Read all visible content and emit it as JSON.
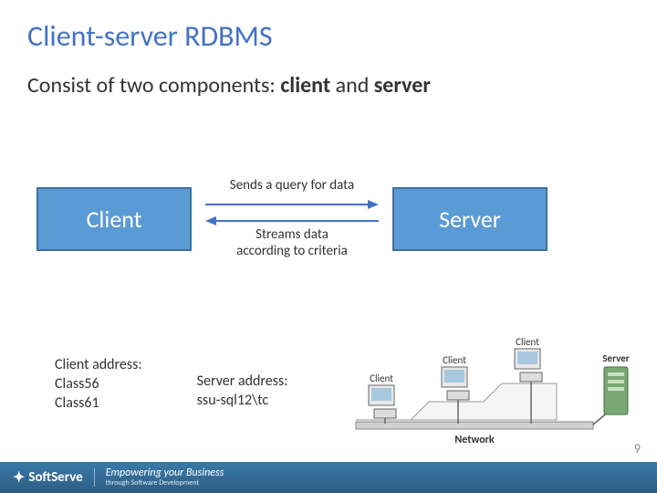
{
  "title": "Client-server RDBMS",
  "subtitle_prefix": "Consist of two components: ",
  "subtitle_bold1": "client",
  "subtitle_mid": " and ",
  "subtitle_bold2": "server",
  "diagram": {
    "client_label": "Client",
    "server_label": "Server",
    "arrow_top": "Sends a query for data",
    "arrow_bottom_line1": "Streams data",
    "arrow_bottom_line2": "according to criteria"
  },
  "client_address": {
    "heading": "Client address:",
    "line1": "Class56",
    "line2": "Class61"
  },
  "server_address": {
    "heading": "Server address:",
    "line1": "ssu-sql12\\tc"
  },
  "network_fig": {
    "client_label": "Client",
    "server_label": "Server",
    "network_label": "Network"
  },
  "footer": {
    "brand": "SoftServe",
    "tagline_main": "Empowering your Business",
    "tagline_sub": "through Software Development"
  },
  "page_number": "9"
}
